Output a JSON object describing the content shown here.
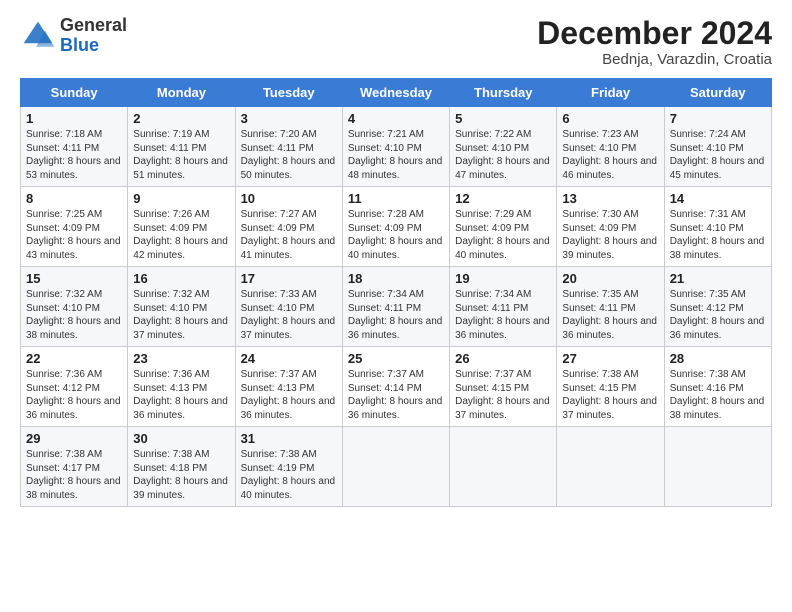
{
  "header": {
    "logo_general": "General",
    "logo_blue": "Blue",
    "month_title": "December 2024",
    "location": "Bednja, Varazdin, Croatia"
  },
  "days_of_week": [
    "Sunday",
    "Monday",
    "Tuesday",
    "Wednesday",
    "Thursday",
    "Friday",
    "Saturday"
  ],
  "weeks": [
    [
      {
        "num": "1",
        "sunrise": "7:18 AM",
        "sunset": "4:11 PM",
        "daylight": "8 hours and 53 minutes."
      },
      {
        "num": "2",
        "sunrise": "7:19 AM",
        "sunset": "4:11 PM",
        "daylight": "8 hours and 51 minutes."
      },
      {
        "num": "3",
        "sunrise": "7:20 AM",
        "sunset": "4:11 PM",
        "daylight": "8 hours and 50 minutes."
      },
      {
        "num": "4",
        "sunrise": "7:21 AM",
        "sunset": "4:10 PM",
        "daylight": "8 hours and 48 minutes."
      },
      {
        "num": "5",
        "sunrise": "7:22 AM",
        "sunset": "4:10 PM",
        "daylight": "8 hours and 47 minutes."
      },
      {
        "num": "6",
        "sunrise": "7:23 AM",
        "sunset": "4:10 PM",
        "daylight": "8 hours and 46 minutes."
      },
      {
        "num": "7",
        "sunrise": "7:24 AM",
        "sunset": "4:10 PM",
        "daylight": "8 hours and 45 minutes."
      }
    ],
    [
      {
        "num": "8",
        "sunrise": "7:25 AM",
        "sunset": "4:09 PM",
        "daylight": "8 hours and 43 minutes."
      },
      {
        "num": "9",
        "sunrise": "7:26 AM",
        "sunset": "4:09 PM",
        "daylight": "8 hours and 42 minutes."
      },
      {
        "num": "10",
        "sunrise": "7:27 AM",
        "sunset": "4:09 PM",
        "daylight": "8 hours and 41 minutes."
      },
      {
        "num": "11",
        "sunrise": "7:28 AM",
        "sunset": "4:09 PM",
        "daylight": "8 hours and 40 minutes."
      },
      {
        "num": "12",
        "sunrise": "7:29 AM",
        "sunset": "4:09 PM",
        "daylight": "8 hours and 40 minutes."
      },
      {
        "num": "13",
        "sunrise": "7:30 AM",
        "sunset": "4:09 PM",
        "daylight": "8 hours and 39 minutes."
      },
      {
        "num": "14",
        "sunrise": "7:31 AM",
        "sunset": "4:10 PM",
        "daylight": "8 hours and 38 minutes."
      }
    ],
    [
      {
        "num": "15",
        "sunrise": "7:32 AM",
        "sunset": "4:10 PM",
        "daylight": "8 hours and 38 minutes."
      },
      {
        "num": "16",
        "sunrise": "7:32 AM",
        "sunset": "4:10 PM",
        "daylight": "8 hours and 37 minutes."
      },
      {
        "num": "17",
        "sunrise": "7:33 AM",
        "sunset": "4:10 PM",
        "daylight": "8 hours and 37 minutes."
      },
      {
        "num": "18",
        "sunrise": "7:34 AM",
        "sunset": "4:11 PM",
        "daylight": "8 hours and 36 minutes."
      },
      {
        "num": "19",
        "sunrise": "7:34 AM",
        "sunset": "4:11 PM",
        "daylight": "8 hours and 36 minutes."
      },
      {
        "num": "20",
        "sunrise": "7:35 AM",
        "sunset": "4:11 PM",
        "daylight": "8 hours and 36 minutes."
      },
      {
        "num": "21",
        "sunrise": "7:35 AM",
        "sunset": "4:12 PM",
        "daylight": "8 hours and 36 minutes."
      }
    ],
    [
      {
        "num": "22",
        "sunrise": "7:36 AM",
        "sunset": "4:12 PM",
        "daylight": "8 hours and 36 minutes."
      },
      {
        "num": "23",
        "sunrise": "7:36 AM",
        "sunset": "4:13 PM",
        "daylight": "8 hours and 36 minutes."
      },
      {
        "num": "24",
        "sunrise": "7:37 AM",
        "sunset": "4:13 PM",
        "daylight": "8 hours and 36 minutes."
      },
      {
        "num": "25",
        "sunrise": "7:37 AM",
        "sunset": "4:14 PM",
        "daylight": "8 hours and 36 minutes."
      },
      {
        "num": "26",
        "sunrise": "7:37 AM",
        "sunset": "4:15 PM",
        "daylight": "8 hours and 37 minutes."
      },
      {
        "num": "27",
        "sunrise": "7:38 AM",
        "sunset": "4:15 PM",
        "daylight": "8 hours and 37 minutes."
      },
      {
        "num": "28",
        "sunrise": "7:38 AM",
        "sunset": "4:16 PM",
        "daylight": "8 hours and 38 minutes."
      }
    ],
    [
      {
        "num": "29",
        "sunrise": "7:38 AM",
        "sunset": "4:17 PM",
        "daylight": "8 hours and 38 minutes."
      },
      {
        "num": "30",
        "sunrise": "7:38 AM",
        "sunset": "4:18 PM",
        "daylight": "8 hours and 39 minutes."
      },
      {
        "num": "31",
        "sunrise": "7:38 AM",
        "sunset": "4:19 PM",
        "daylight": "8 hours and 40 minutes."
      },
      null,
      null,
      null,
      null
    ]
  ]
}
